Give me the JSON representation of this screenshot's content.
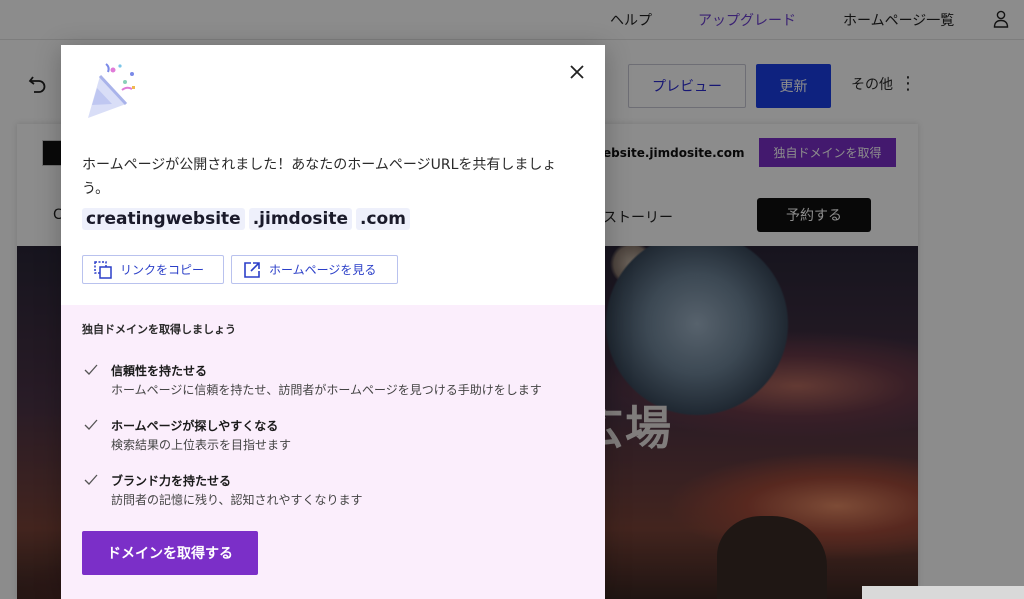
{
  "topbar": {
    "help": "ヘルプ",
    "upgrade": "アップグレード",
    "sites": "ホームページ一覧",
    "upgrade_color": "#6c3fd1"
  },
  "editor": {
    "preview": "プレビュー",
    "update": "更新",
    "more": "その他",
    "update_color": "#1b3ee8"
  },
  "site": {
    "url": "ebsite.jimdosite.com",
    "get_domain": "独自ドメインを取得",
    "nav_partial_left": "C",
    "nav_story": "ストーリー",
    "reserve": "予約する",
    "hero_title": "広場"
  },
  "modal": {
    "icon": "party-popper-icon",
    "message": "ホームページが公開されました！あなたのホームページURLを共有しましょう。",
    "url_parts": [
      "creatingwebsite",
      ".jimdosite",
      ".com"
    ],
    "copy_link": "リンクをコピー",
    "view_site": "ホームページを見る",
    "domain_heading": "独自ドメインを取得しましょう",
    "benefits": [
      {
        "title": "信頼性を持たせる",
        "desc": "ホームページに信頼を持たせ、訪問者がホームページを見つける手助けをします"
      },
      {
        "title": "ホームページが探しやすくなる",
        "desc": "検索結果の上位表示を目指せます"
      },
      {
        "title": "ブランド力を持たせる",
        "desc": "訪問者の記憶に残り、認知されやすくなります"
      }
    ],
    "get_domain_button": "ドメインを取得する",
    "accent_color": "#7b2fc8",
    "panel_color": "#fbeefc"
  }
}
